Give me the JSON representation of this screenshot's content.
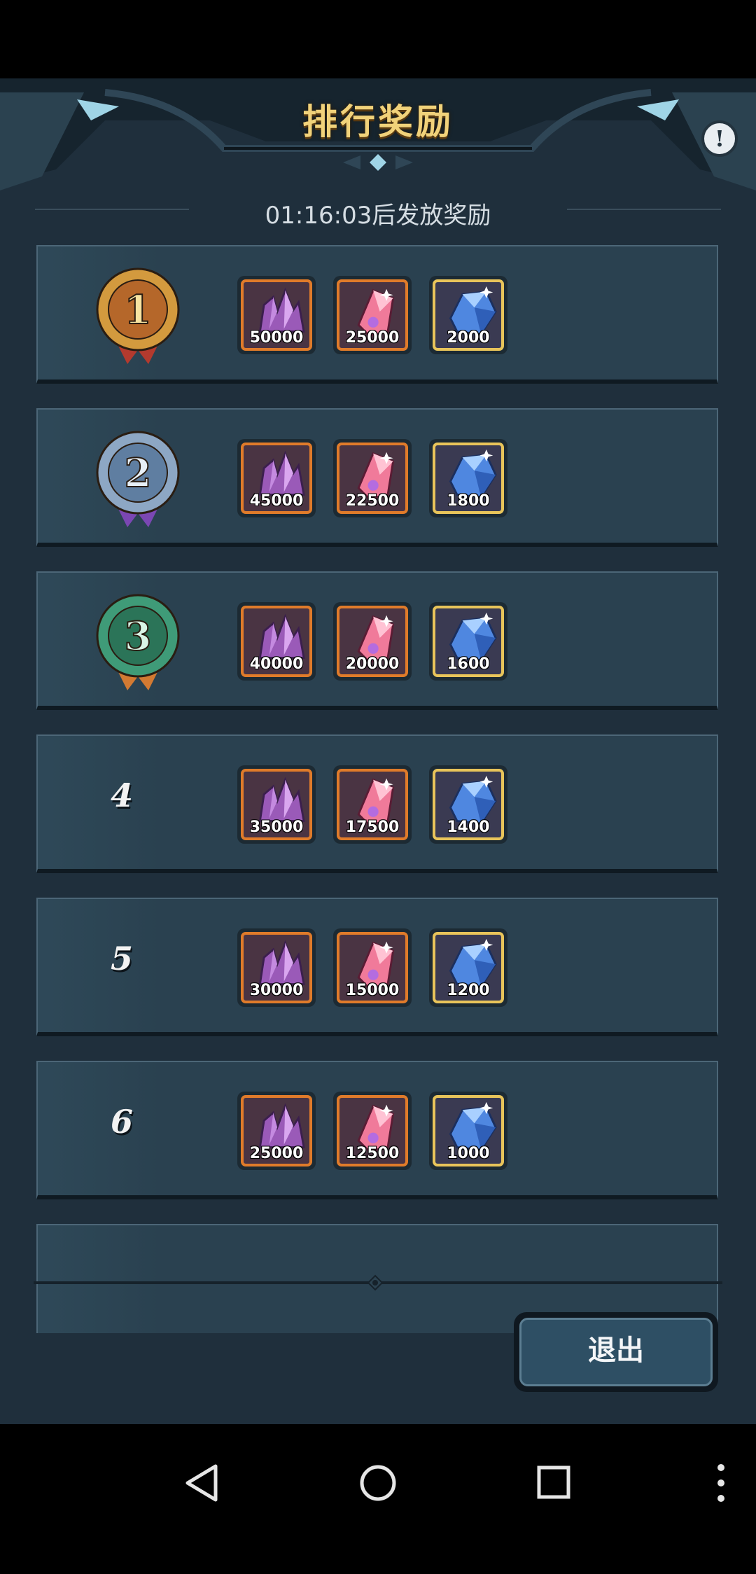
{
  "header": {
    "title": "排行奖励",
    "info_icon_glyph": "!"
  },
  "countdown": "01:16:03后发放奖励",
  "rows": [
    {
      "rank": "1",
      "medal": "gold-medal",
      "rewards": [
        {
          "icon": "purple-crystal-icon",
          "qty": "50000"
        },
        {
          "icon": "pink-gem-icon",
          "qty": "25000"
        },
        {
          "icon": "blue-diamond-icon",
          "qty": "2000"
        }
      ]
    },
    {
      "rank": "2",
      "medal": "silver-medal",
      "rewards": [
        {
          "icon": "purple-crystal-icon",
          "qty": "45000"
        },
        {
          "icon": "pink-gem-icon",
          "qty": "22500"
        },
        {
          "icon": "blue-diamond-icon",
          "qty": "1800"
        }
      ]
    },
    {
      "rank": "3",
      "medal": "green-medal",
      "rewards": [
        {
          "icon": "purple-crystal-icon",
          "qty": "40000"
        },
        {
          "icon": "pink-gem-icon",
          "qty": "20000"
        },
        {
          "icon": "blue-diamond-icon",
          "qty": "1600"
        }
      ]
    },
    {
      "rank": "4",
      "rewards": [
        {
          "icon": "purple-crystal-icon",
          "qty": "35000"
        },
        {
          "icon": "pink-gem-icon",
          "qty": "17500"
        },
        {
          "icon": "blue-diamond-icon",
          "qty": "1400"
        }
      ]
    },
    {
      "rank": "5",
      "rewards": [
        {
          "icon": "purple-crystal-icon",
          "qty": "30000"
        },
        {
          "icon": "pink-gem-icon",
          "qty": "15000"
        },
        {
          "icon": "blue-diamond-icon",
          "qty": "1200"
        }
      ]
    },
    {
      "rank": "6",
      "rewards": [
        {
          "icon": "purple-crystal-icon",
          "qty": "25000"
        },
        {
          "icon": "pink-gem-icon",
          "qty": "12500"
        },
        {
          "icon": "blue-diamond-icon",
          "qty": "1000"
        }
      ]
    }
  ],
  "exit_button": {
    "label": "退出"
  },
  "colors": {
    "panel_bg": "#1f2f3c",
    "row_bg": "#2a4150",
    "title": "#f1d27a",
    "orange_frame": "#e07b2a",
    "gold_frame": "#e8c45a"
  },
  "nav": {
    "back": "back-icon",
    "home": "home-icon",
    "recents": "recents-icon",
    "more": "more-icon"
  }
}
